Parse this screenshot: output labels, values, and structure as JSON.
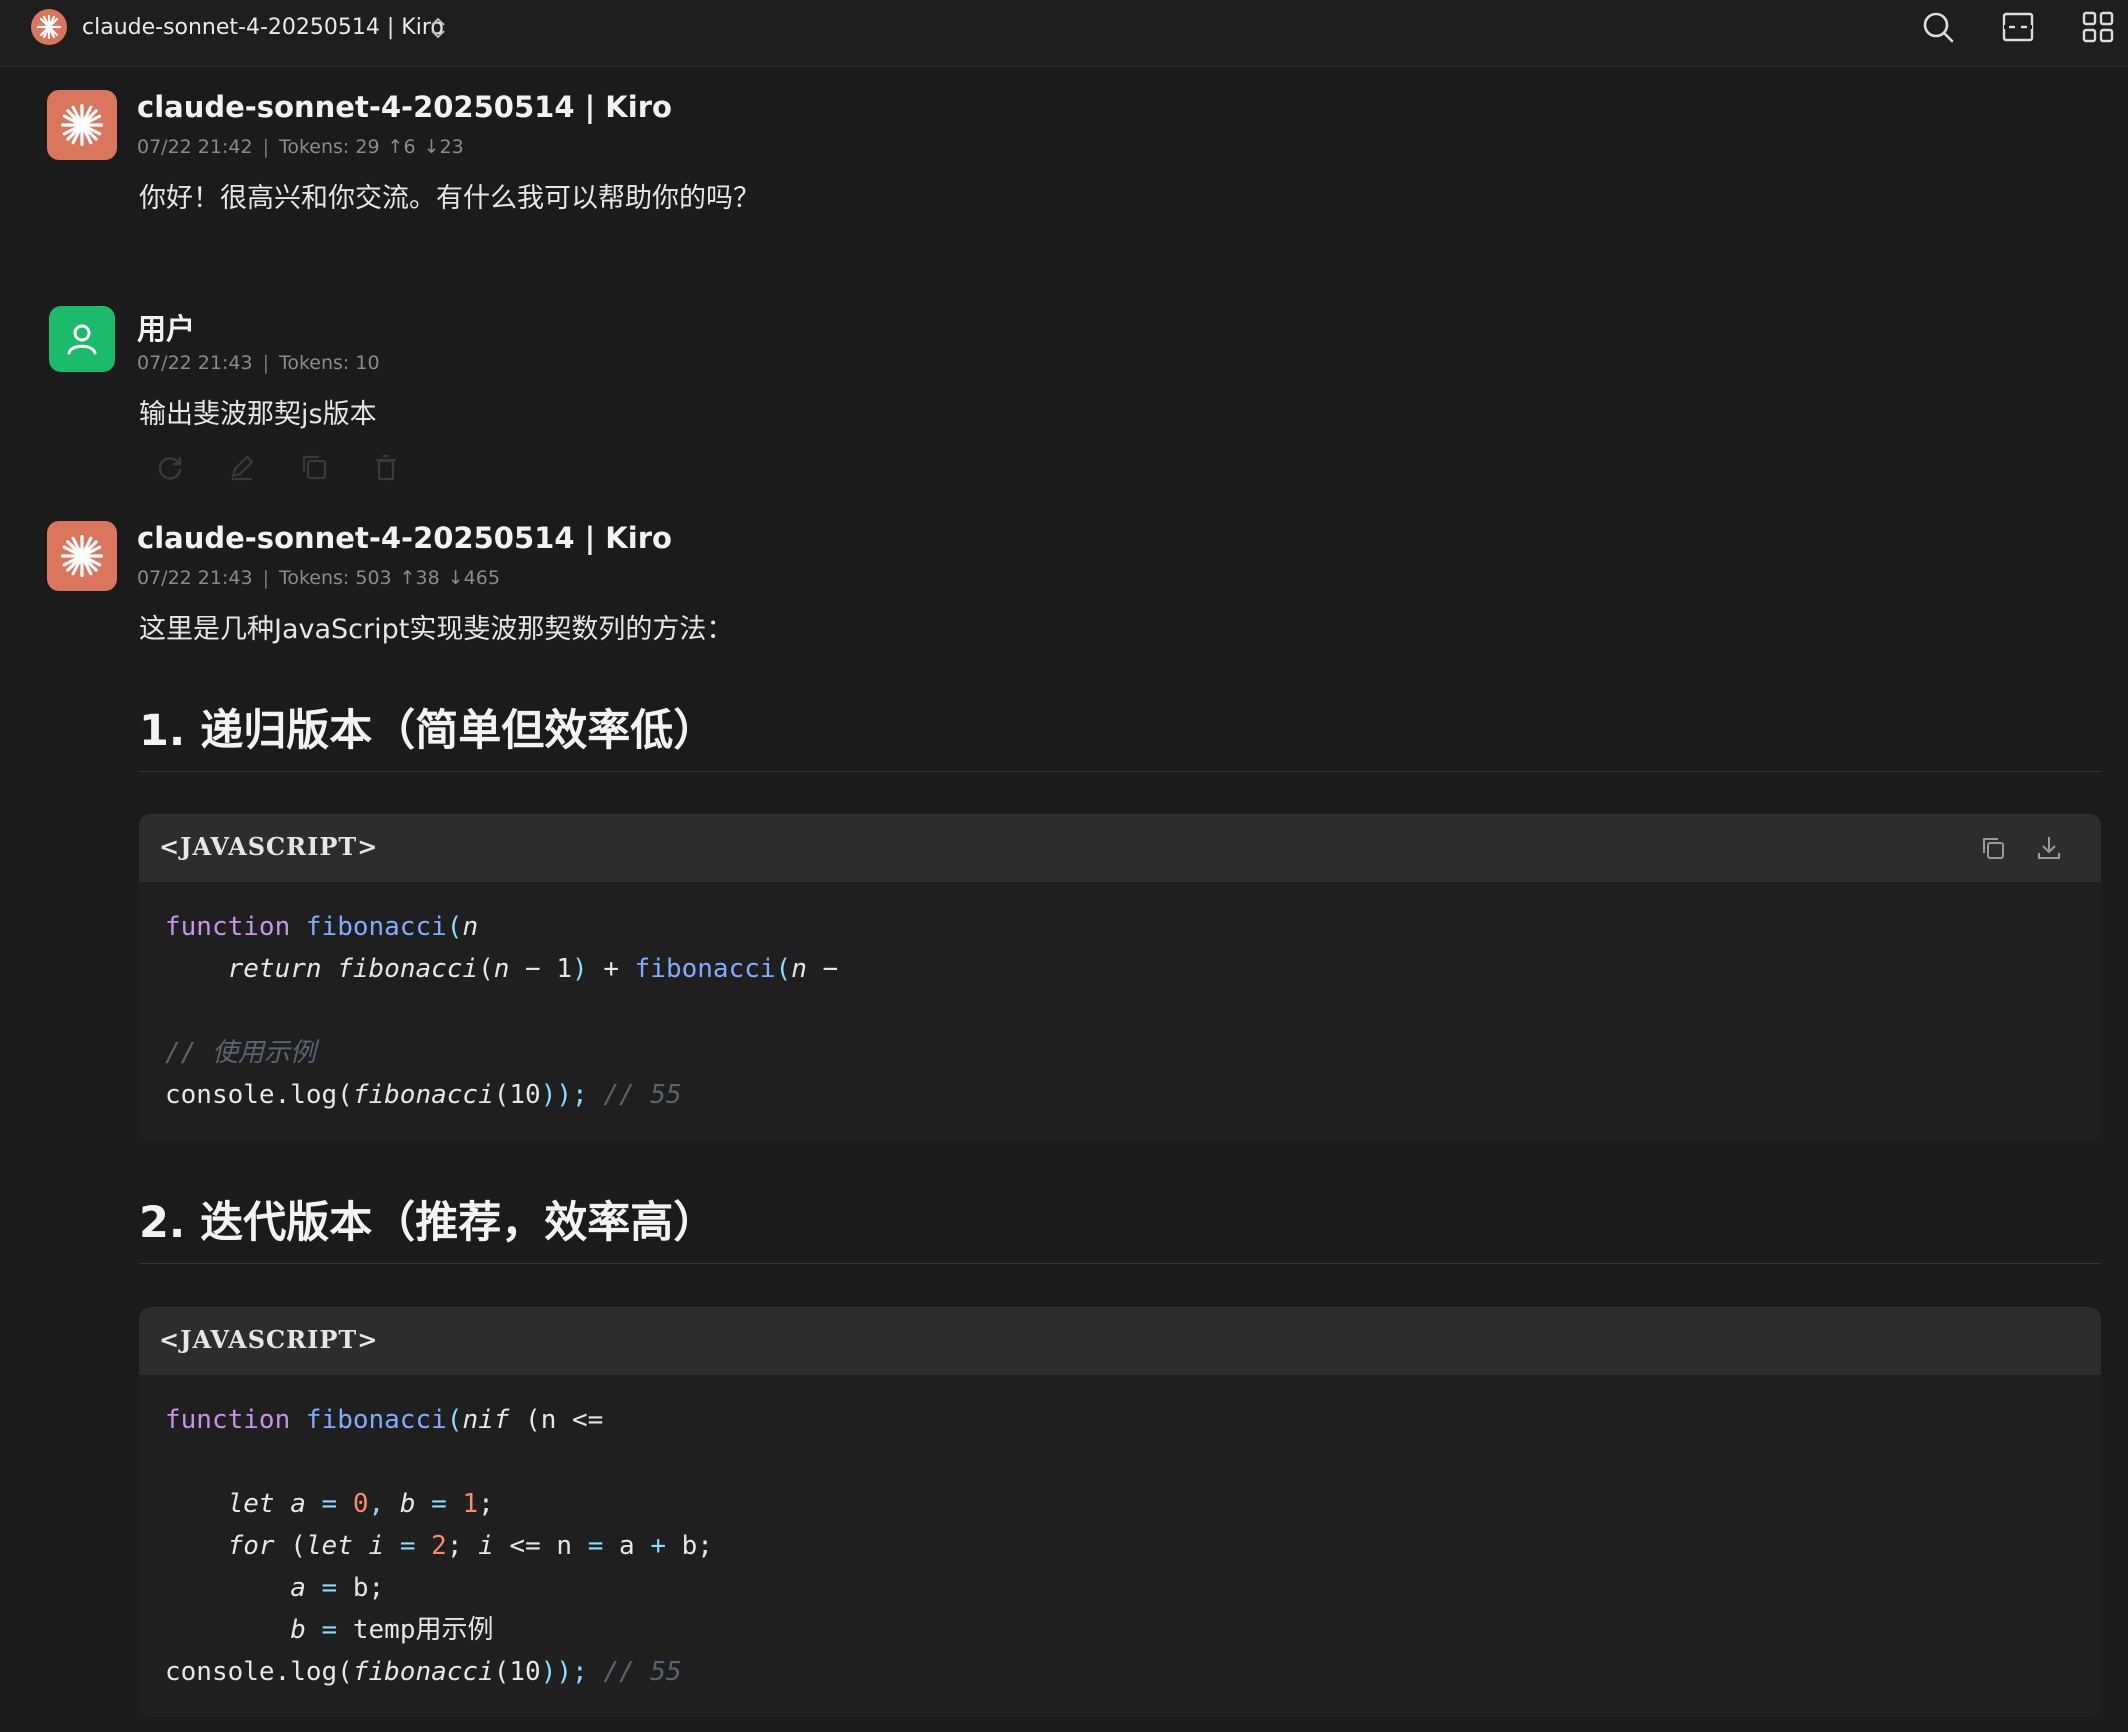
{
  "topbar": {
    "title": "claude-sonnet-4-20250514 | Kiro",
    "icons": [
      "app-logo-icon",
      "chevron-updown-icon",
      "search-icon",
      "collapse-icon",
      "grid-icon"
    ]
  },
  "messages": [
    {
      "sender": "claude-sonnet-4-20250514 | Kiro",
      "time": "07/22 21:42",
      "tokens": "Tokens: 29",
      "up": "↑6",
      "down": "↓23",
      "text": "你好！很高兴和你交流。有什么我可以帮助你的吗？"
    },
    {
      "sender": "用户",
      "time": "07/22 21:43",
      "tokens": "Tokens: 10",
      "text": "输出斐波那契js版本"
    },
    {
      "sender": "claude-sonnet-4-20250514 | Kiro",
      "time": "07/22 21:43",
      "tokens": "Tokens: 503",
      "up": "↑38",
      "down": "↓465",
      "text": "这里是几种JavaScript实现斐波那契数列的方法："
    }
  ],
  "sections": [
    {
      "heading": "1. 递归版本（简单但效率低）",
      "lang": "<JAVASCRIPT>"
    },
    {
      "heading": "2. 迭代版本（推荐，效率高）",
      "lang": "<JAVASCRIPT>"
    }
  ],
  "code1": {
    "l1_kw": "function",
    "l1_fn": "fibonacci",
    "l1_paren": "(",
    "l1_arg": "n",
    "l2_indent": "    ",
    "l2_ret": "return",
    "l2_fn": "fibonacci",
    "l2_a": "(",
    "l2_b": "n",
    "l2_c": " − 1",
    "l2_d": ")",
    "l2_plus": " + ",
    "l2_fn2": "fibonacci",
    "l2_e": "(",
    "l2_f": "n",
    "l2_g": " −",
    "l4_comment": "// 使用示例",
    "l5_a": "console.log(",
    "l5_fn": "fibonacci",
    "l5_b": "(10",
    "l5_c": "));",
    "l5_comment": " // 55"
  },
  "code2": {
    "l1_kw": "function",
    "l1_fn": "fibonacci",
    "l1_paren": "(",
    "l1_arg": "nif",
    "l1_rest": " (n <=",
    "l3_let": "let",
    "l3_a": "a",
    "l3_eq": " = ",
    "l3_zero": "0",
    "l3_comma": ", ",
    "l3_b": "b",
    "l3_eq2": " = ",
    "l3_one": "1",
    "l3_semi": ";",
    "l4_for": "for",
    "l4_a": " (",
    "l4_let": "let",
    "l4_i": " i",
    "l4_eq": " = ",
    "l4_two": "2",
    "l4_b": "; ",
    "l4_i2": "i",
    "l4_c": " <= n ",
    "l4_eq2": "=",
    "l4_d": " a ",
    "l4_plus": "+",
    "l4_e": " b;",
    "l5_a": "a",
    "l5_eq": " = ",
    "l5_b": "b;",
    "l6_b": "b",
    "l6_eq": " = ",
    "l6_c": "temp用示例",
    "l7_a": "console.log(",
    "l7_fn": "fibonacci",
    "l7_b": "(10",
    "l7_c": "));",
    "l7_comment": " // 55"
  }
}
